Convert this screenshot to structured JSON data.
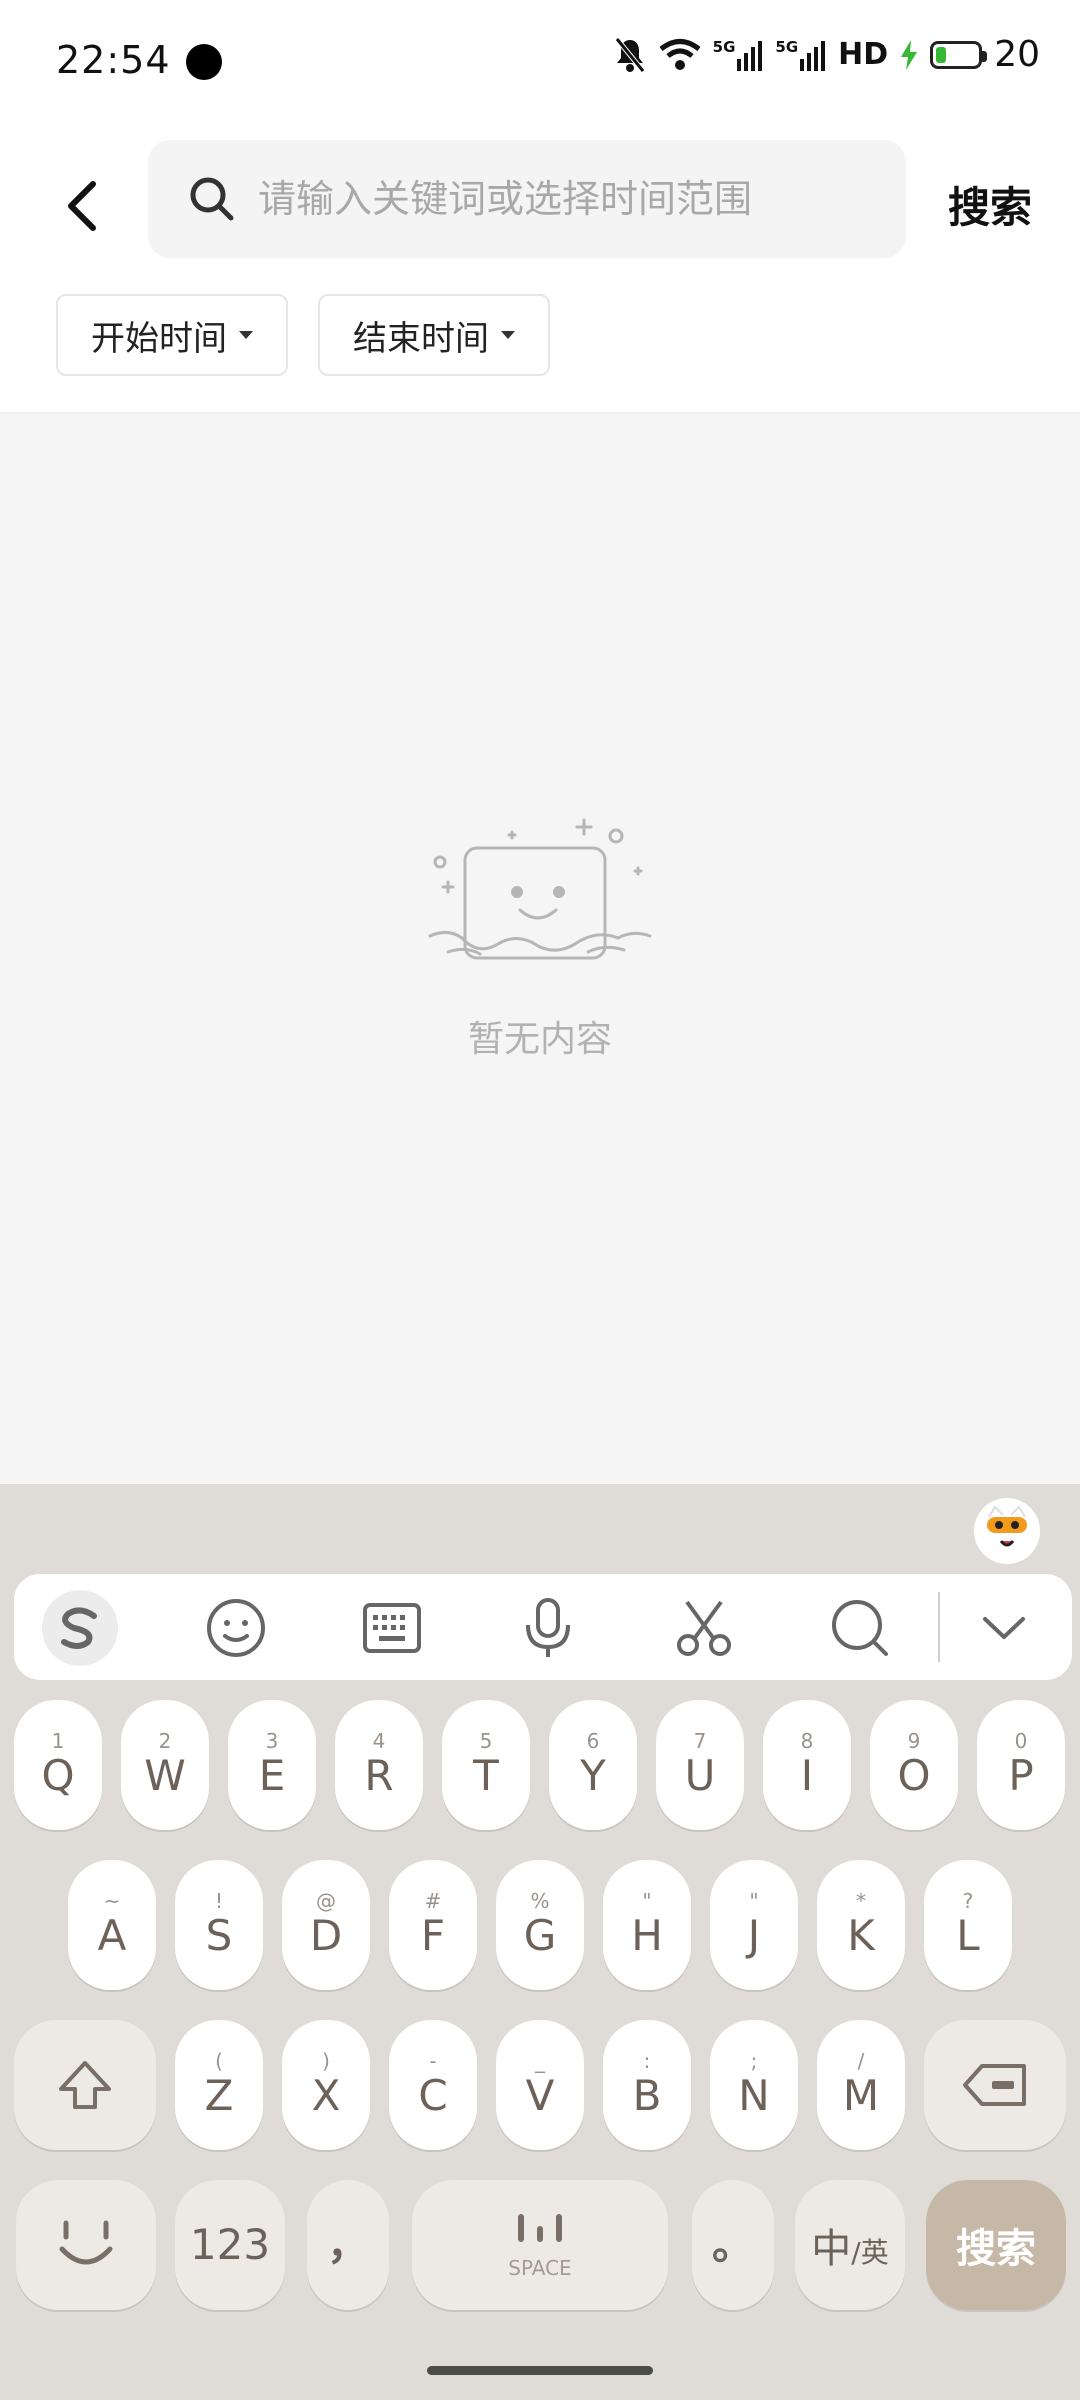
{
  "status": {
    "time": "22:54",
    "icons": [
      "mute-bell-icon",
      "wifi-icon",
      "signal-5g-icon",
      "signal-5g-icon",
      "hd-icon",
      "charging-icon",
      "battery-icon"
    ],
    "network_1": "5G",
    "network_2": "5G",
    "hd_label": "HD",
    "battery_level": "20",
    "battery_color": "#35b935"
  },
  "header": {
    "back_icon": "chevron-left-icon",
    "search_placeholder": "请输入关键词或选择时间范围",
    "search_value": "",
    "search_button": "搜索"
  },
  "filters": {
    "start_label": "开始时间",
    "end_label": "结束时间"
  },
  "empty_state": {
    "icon": "empty-box-icon",
    "text": "暂无内容"
  },
  "keyboard": {
    "toolbar": [
      "sogou-logo-icon",
      "emoji-icon",
      "keyboard-icon",
      "microphone-icon",
      "scissors-icon",
      "search-icon",
      "collapse-chevron-icon"
    ],
    "row1": [
      {
        "main": "Q",
        "sub": "1"
      },
      {
        "main": "W",
        "sub": "2"
      },
      {
        "main": "E",
        "sub": "3"
      },
      {
        "main": "R",
        "sub": "4"
      },
      {
        "main": "T",
        "sub": "5"
      },
      {
        "main": "Y",
        "sub": "6"
      },
      {
        "main": "U",
        "sub": "7"
      },
      {
        "main": "I",
        "sub": "8"
      },
      {
        "main": "O",
        "sub": "9"
      },
      {
        "main": "P",
        "sub": "0"
      }
    ],
    "row2": [
      {
        "main": "A",
        "sub": "~"
      },
      {
        "main": "S",
        "sub": "!"
      },
      {
        "main": "D",
        "sub": "@"
      },
      {
        "main": "F",
        "sub": "#"
      },
      {
        "main": "G",
        "sub": "%"
      },
      {
        "main": "H",
        "sub": "\""
      },
      {
        "main": "J",
        "sub": "\""
      },
      {
        "main": "K",
        "sub": "*"
      },
      {
        "main": "L",
        "sub": "?"
      }
    ],
    "row3": [
      {
        "main": "Z",
        "sub": "("
      },
      {
        "main": "X",
        "sub": ")"
      },
      {
        "main": "C",
        "sub": "-"
      },
      {
        "main": "V",
        "sub": "_"
      },
      {
        "main": "B",
        "sub": ":"
      },
      {
        "main": "N",
        "sub": ";"
      },
      {
        "main": "M",
        "sub": "/"
      }
    ],
    "key_123": "123",
    "key_comma": "，",
    "key_space": "SPACE",
    "key_period": "。",
    "key_lang_main": "中",
    "key_lang_sub": "/英",
    "key_enter": "搜索"
  }
}
